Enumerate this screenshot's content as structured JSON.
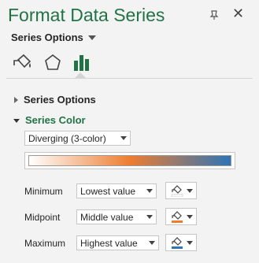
{
  "pane": {
    "title": "Format Data Series",
    "options_dropdown": "Series Options",
    "close_glyph": "✕",
    "tabs": [
      {
        "icon": "fill-bucket-icon"
      },
      {
        "icon": "pentagon-icon"
      },
      {
        "icon": "bar-chart-icon"
      }
    ]
  },
  "sections": {
    "series_options": "Series Options",
    "series_color": "Series Color"
  },
  "colors": {
    "accent": "#217346",
    "gradient_low": "#ffffff",
    "gradient_mid": "#ed7d31",
    "gradient_high": "#2e75b6"
  },
  "color_scheme": {
    "selected": "Diverging (3-color)"
  },
  "rows": [
    {
      "label": "Minimum",
      "value": "Lowest value"
    },
    {
      "label": "Midpoint",
      "value": "Middle value"
    },
    {
      "label": "Maximum",
      "value": "Highest value"
    }
  ]
}
